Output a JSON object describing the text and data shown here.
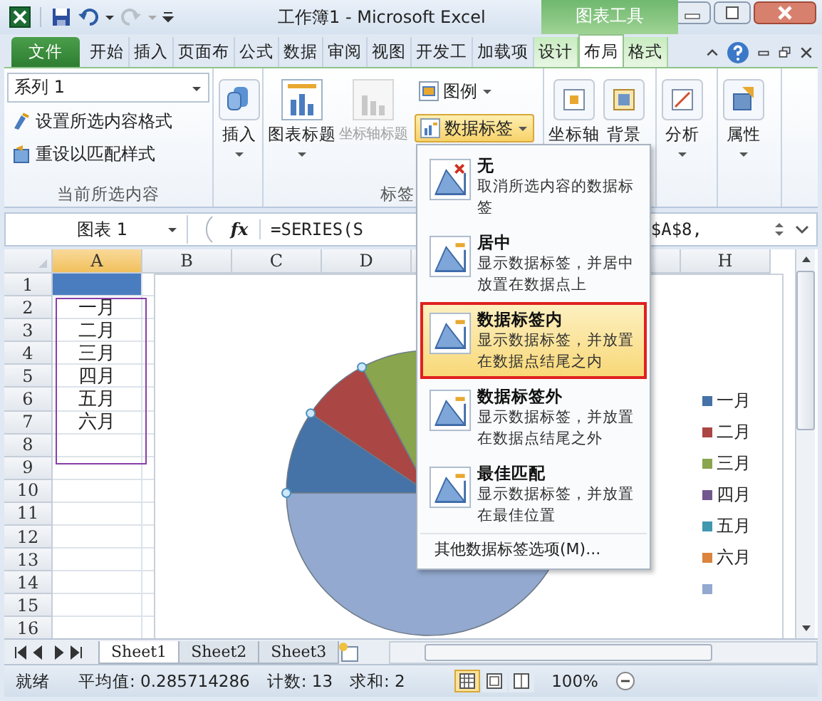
{
  "title_bar": {
    "title": "工作簿1  -  Microsoft Excel",
    "context_tab": "图表工具"
  },
  "ribbon_tabs": [
    {
      "label": "文件",
      "kind": "file",
      "selected": false
    },
    {
      "label": "开始",
      "kind": "normal",
      "selected": false
    },
    {
      "label": "插入",
      "kind": "normal",
      "selected": false
    },
    {
      "label": "页面布",
      "kind": "normal",
      "selected": false
    },
    {
      "label": "公式",
      "kind": "normal",
      "selected": false
    },
    {
      "label": "数据",
      "kind": "normal",
      "selected": false
    },
    {
      "label": "审阅",
      "kind": "normal",
      "selected": false
    },
    {
      "label": "视图",
      "kind": "normal",
      "selected": false
    },
    {
      "label": "开发工",
      "kind": "normal",
      "selected": false
    },
    {
      "label": "加载项",
      "kind": "normal",
      "selected": false
    },
    {
      "label": "设计",
      "kind": "context",
      "selected": false
    },
    {
      "label": "布局",
      "kind": "context",
      "selected": true
    },
    {
      "label": "格式",
      "kind": "context",
      "selected": false
    }
  ],
  "ribbon": {
    "selection_box": "系列 1",
    "format_selection": "设置所选内容格式",
    "reset_style": "重设以匹配样式",
    "current_group": "当前所选内容",
    "insert": "插入",
    "chart_title": "图表标题",
    "axis_title": {
      "label": "坐标轴标题",
      "disabled": true
    },
    "legend": "图例",
    "data_labels": {
      "label": "数据标签",
      "pressed": true
    },
    "labels_group": "标签",
    "axes": "坐标轴",
    "background": "背景",
    "analysis": "分析",
    "properties": "属性"
  },
  "formula_bar": {
    "name_box": "图表 1",
    "function_label": "fx",
    "formula_parts": [
      "=SERIES(S",
      "$A$8,"
    ]
  },
  "columns": [
    "A",
    "B",
    "C",
    "D",
    "H"
  ],
  "rows": [
    "1",
    "2",
    "3",
    "4",
    "5",
    "6",
    "7",
    "8",
    "9",
    "10",
    "11",
    "12",
    "13",
    "14",
    "15",
    "16"
  ],
  "cells": [
    "一月",
    "二月",
    "三月",
    "四月",
    "五月",
    "六月"
  ],
  "legend": [
    {
      "label": "一月",
      "color": "#4572a7"
    },
    {
      "label": "二月",
      "color": "#aa4643"
    },
    {
      "label": "三月",
      "color": "#89a54e"
    },
    {
      "label": "四月",
      "color": "#71588f"
    },
    {
      "label": "五月",
      "color": "#4198af"
    },
    {
      "label": "六月",
      "color": "#db843d"
    },
    {
      "color": "#93a9cf"
    }
  ],
  "menu": {
    "items": [
      {
        "title": "无",
        "description": "取消所选内容的数据标签",
        "selected": false,
        "kind": "none"
      },
      {
        "title": "居中",
        "description": "显示数据标签，并居中放置在数据点上",
        "selected": false,
        "kind": "label"
      },
      {
        "title": "数据标签内",
        "description": "显示数据标签，并放置在数据点结尾之内",
        "selected": true,
        "kind": "label"
      },
      {
        "title": "数据标签外",
        "description": "显示数据标签，并放置在数据点结尾之外",
        "selected": false,
        "kind": "label"
      },
      {
        "title": "最佳匹配",
        "description": "显示数据标签，并放置在最佳位置",
        "selected": false,
        "kind": "label"
      }
    ],
    "footer": "其他数据标签选项(M)..."
  },
  "sheet_tabs": [
    {
      "label": "Sheet1",
      "selected": true
    },
    {
      "label": "Sheet2",
      "selected": false
    },
    {
      "label": "Sheet3",
      "selected": false
    }
  ],
  "status_bar": {
    "ready": "就绪",
    "average": "平均值: 0.285714286",
    "count": "计数: 13",
    "sum": "求和: 2",
    "zoom": "100%",
    "view_buttons": [
      {
        "selected": true
      },
      {
        "selected": false
      },
      {
        "selected": false
      }
    ]
  }
}
